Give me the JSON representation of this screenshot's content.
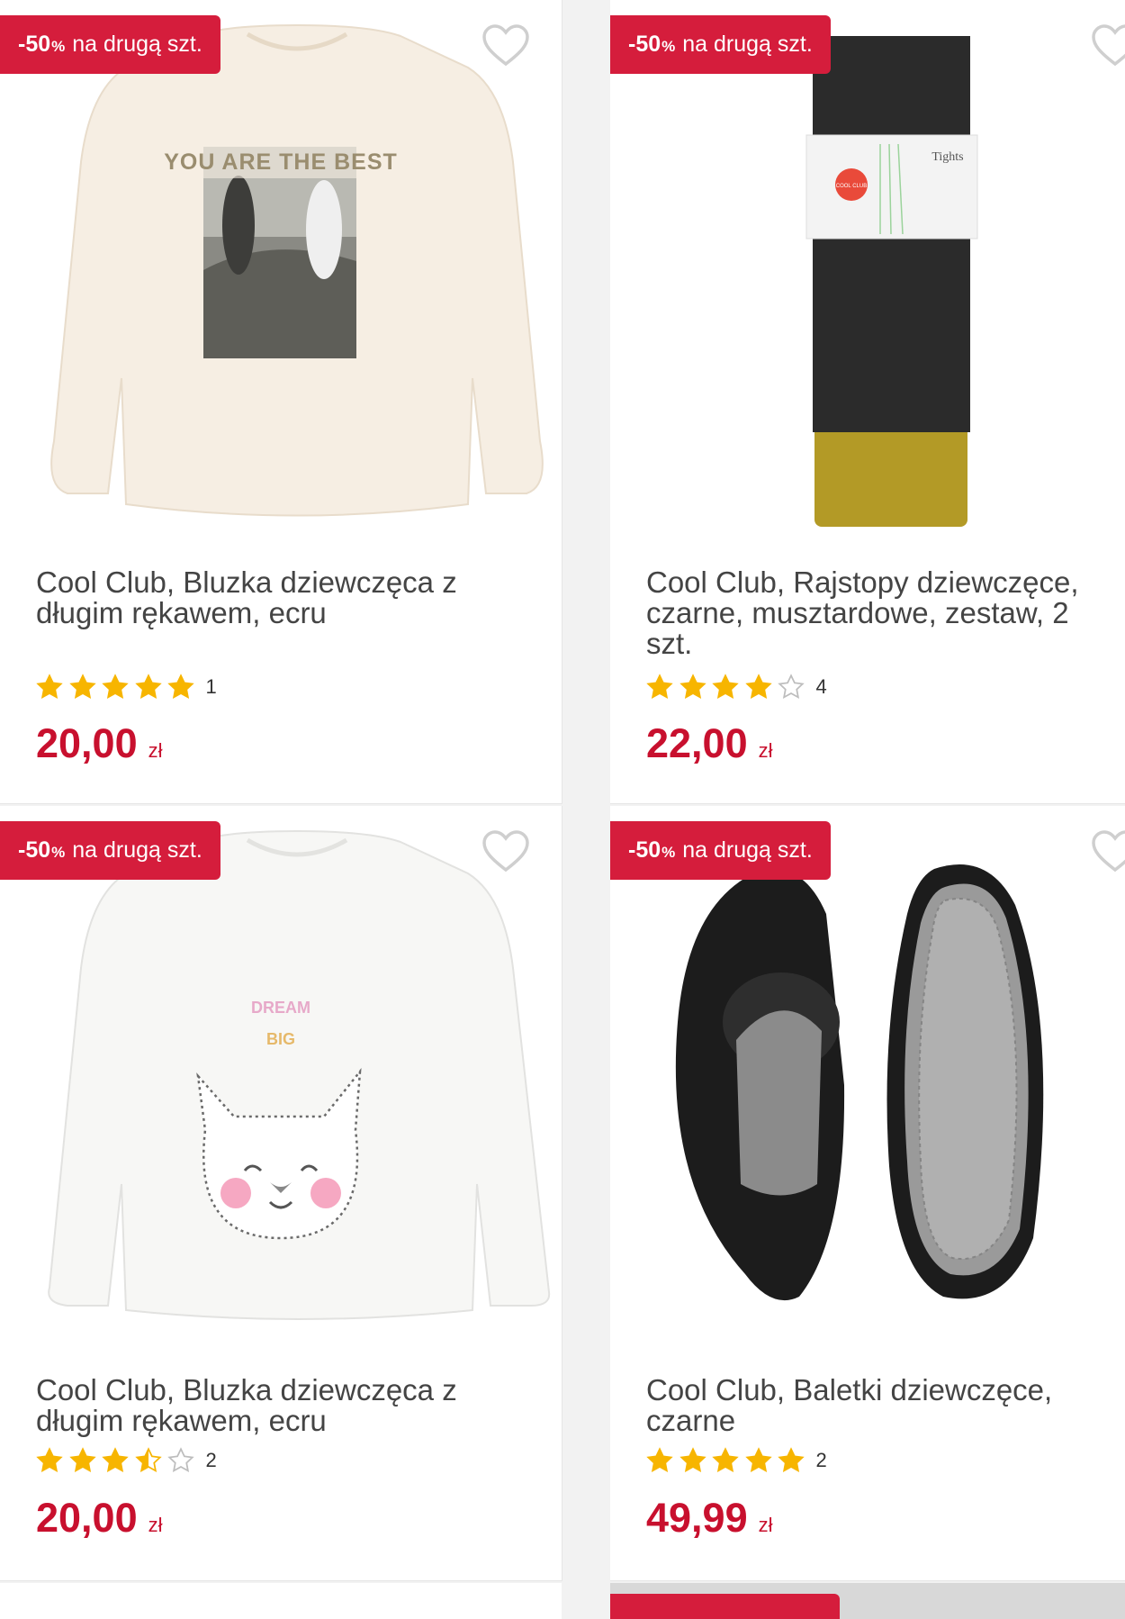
{
  "badge": {
    "percent": "-50",
    "percent_sign": "%",
    "text": "na drugą szt."
  },
  "currency": "zł",
  "products": [
    {
      "title": "Cool Club, Bluzka dziewczęca z długim rękawem, ecru",
      "rating": 5,
      "reviews": "1",
      "price": "20,00",
      "image": "cream-girls-longsleeve-tshirt-photo-print",
      "print_text": "YOU ARE THE BEST"
    },
    {
      "title": "Cool Club, Rajstopy dziewczęce, czarne, musztardowe, zestaw, 2 szt.",
      "rating": 4,
      "reviews": "4",
      "price": "22,00",
      "image": "black-mustard-tights-2-pack",
      "label_brand": "COOL CLUB",
      "label_text": "Tights"
    },
    {
      "title": "Cool Club, Bluzka dziewczęca z długim rękawem, ecru",
      "rating": 3.5,
      "reviews": "2",
      "price": "20,00",
      "image": "white-longsleeve-llama-print",
      "print_text_1": "DREAM",
      "print_text_2": "BIG"
    },
    {
      "title": "Cool Club, Baletki dziewczęce, czarne",
      "rating": 5,
      "reviews": "2",
      "price": "49,99",
      "image": "black-ballet-shoes"
    }
  ],
  "colors": {
    "accent": "#d51d3c",
    "price": "#c8102e",
    "star": "#f7b500",
    "star_empty": "#bdbdbd"
  },
  "icons": {
    "wishlist": "heart-outline-icon",
    "rating": "star-icon"
  }
}
